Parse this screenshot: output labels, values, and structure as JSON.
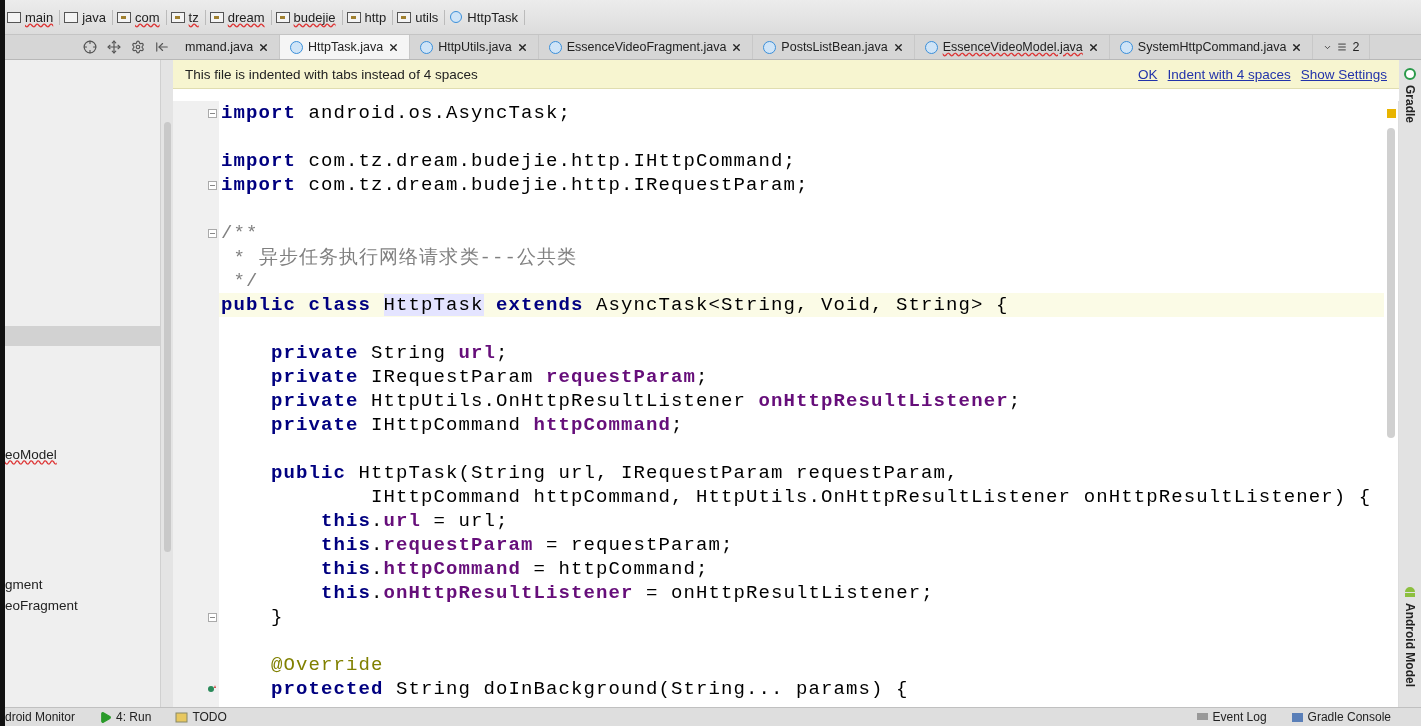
{
  "breadcrumbs": [
    {
      "label": "main",
      "kind": "folder",
      "misspelled": true
    },
    {
      "label": "java",
      "kind": "source",
      "misspelled": false
    },
    {
      "label": "com",
      "kind": "package",
      "misspelled": true
    },
    {
      "label": "tz",
      "kind": "package",
      "misspelled": true
    },
    {
      "label": "dream",
      "kind": "package",
      "misspelled": true
    },
    {
      "label": "budejie",
      "kind": "package",
      "misspelled": true
    },
    {
      "label": "http",
      "kind": "package",
      "misspelled": false
    },
    {
      "label": "utils",
      "kind": "package",
      "misspelled": false
    },
    {
      "label": "HttpTask",
      "kind": "class",
      "misspelled": false
    }
  ],
  "tabs": [
    {
      "label": "mmand.java",
      "selected": false,
      "misspelled": false,
      "icon": false
    },
    {
      "label": "HttpTask.java",
      "selected": true,
      "misspelled": false,
      "icon": true
    },
    {
      "label": "HttpUtils.java",
      "selected": false,
      "misspelled": false,
      "icon": true
    },
    {
      "label": "EssenceVideoFragment.java",
      "selected": false,
      "misspelled": false,
      "icon": true
    },
    {
      "label": "PostsListBean.java",
      "selected": false,
      "misspelled": false,
      "icon": true
    },
    {
      "label": "EssenceVideoModel.java",
      "selected": false,
      "misspelled": true,
      "icon": true
    },
    {
      "label": "SystemHttpCommand.java",
      "selected": false,
      "misspelled": false,
      "icon": true
    }
  ],
  "tab_overflow": "2",
  "project_tree": [
    {
      "selected": true
    },
    {
      "label": "eoModel",
      "selected": false,
      "misspelled": true
    },
    {
      "label": "gment",
      "selected": false,
      "misspelled": false
    },
    {
      "label": "eoFragment",
      "selected": false,
      "misspelled": false
    }
  ],
  "notification": {
    "message": "This file is indented with tabs instead of 4 spaces",
    "actions": [
      "OK",
      "Indent with 4 spaces",
      "Show Settings"
    ]
  },
  "code": [
    {
      "kind": "code",
      "fold": true,
      "tokens": [
        {
          "kind": "keyword",
          "text": "import"
        },
        {
          "kind": "plain",
          "text": " android.os.AsyncTask;"
        }
      ]
    },
    {
      "kind": "blank"
    },
    {
      "kind": "code",
      "tokens": [
        {
          "kind": "keyword",
          "text": "import"
        },
        {
          "kind": "plain",
          "text": " com.tz.dream.budejie.http.IHttpCommand;"
        }
      ]
    },
    {
      "kind": "code",
      "fold": true,
      "tokens": [
        {
          "kind": "keyword",
          "text": "import"
        },
        {
          "kind": "plain",
          "text": " com.tz.dream.budejie.http.IRequestParam;"
        }
      ]
    },
    {
      "kind": "blank"
    },
    {
      "kind": "code",
      "fold": true,
      "tokens": [
        {
          "kind": "comment",
          "text": "/**"
        }
      ]
    },
    {
      "kind": "code",
      "tokens": [
        {
          "kind": "comment",
          "text": " * 异步任务执行网络请求类---公共类"
        }
      ]
    },
    {
      "kind": "code",
      "tokens": [
        {
          "kind": "comment",
          "text": " */"
        }
      ]
    },
    {
      "kind": "code",
      "current": true,
      "tokens": [
        {
          "kind": "keyword",
          "text": "public class "
        },
        {
          "kind": "usage",
          "text": "HttpTask"
        },
        {
          "kind": "keyword",
          "text": " extends"
        },
        {
          "kind": "plain",
          "text": " AsyncTask<String, Void, String> {"
        }
      ]
    },
    {
      "kind": "blank"
    },
    {
      "kind": "code",
      "tokens": [
        {
          "kind": "keyword",
          "text": "    private"
        },
        {
          "kind": "plain",
          "text": " String "
        },
        {
          "kind": "field",
          "text": "url"
        },
        {
          "kind": "plain",
          "text": ";"
        }
      ]
    },
    {
      "kind": "code",
      "tokens": [
        {
          "kind": "keyword",
          "text": "    private"
        },
        {
          "kind": "plain",
          "text": " IRequestParam "
        },
        {
          "kind": "field",
          "text": "requestParam"
        },
        {
          "kind": "plain",
          "text": ";"
        }
      ]
    },
    {
      "kind": "code",
      "tokens": [
        {
          "kind": "keyword",
          "text": "    private"
        },
        {
          "kind": "plain",
          "text": " HttpUtils.OnHttpResultListener "
        },
        {
          "kind": "field",
          "text": "onHttpResultListener"
        },
        {
          "kind": "plain",
          "text": ";"
        }
      ]
    },
    {
      "kind": "code",
      "tokens": [
        {
          "kind": "keyword",
          "text": "    private"
        },
        {
          "kind": "plain",
          "text": " IHttpCommand "
        },
        {
          "kind": "field",
          "text": "httpCommand"
        },
        {
          "kind": "plain",
          "text": ";"
        }
      ]
    },
    {
      "kind": "blank"
    },
    {
      "kind": "code",
      "tokens": [
        {
          "kind": "keyword",
          "text": "    public"
        },
        {
          "kind": "plain",
          "text": " HttpTask(String url, IRequestParam requestParam,"
        }
      ]
    },
    {
      "kind": "code",
      "tokens": [
        {
          "kind": "plain",
          "text": "            IHttpCommand httpCommand, HttpUtils.OnHttpResultListener onHttpResultListener) {"
        }
      ]
    },
    {
      "kind": "code",
      "tokens": [
        {
          "kind": "keyword",
          "text": "        this"
        },
        {
          "kind": "plain",
          "text": "."
        },
        {
          "kind": "field",
          "text": "url"
        },
        {
          "kind": "plain",
          "text": " = url;"
        }
      ]
    },
    {
      "kind": "code",
      "tokens": [
        {
          "kind": "keyword",
          "text": "        this"
        },
        {
          "kind": "plain",
          "text": "."
        },
        {
          "kind": "field",
          "text": "requestParam"
        },
        {
          "kind": "plain",
          "text": " = requestParam;"
        }
      ]
    },
    {
      "kind": "code",
      "tokens": [
        {
          "kind": "keyword",
          "text": "        this"
        },
        {
          "kind": "plain",
          "text": "."
        },
        {
          "kind": "field",
          "text": "httpCommand"
        },
        {
          "kind": "plain",
          "text": " = httpCommand;"
        }
      ]
    },
    {
      "kind": "code",
      "tokens": [
        {
          "kind": "keyword",
          "text": "        this"
        },
        {
          "kind": "plain",
          "text": "."
        },
        {
          "kind": "field",
          "text": "onHttpResultListener"
        },
        {
          "kind": "plain",
          "text": " = onHttpResultListener;"
        }
      ]
    },
    {
      "kind": "code",
      "fold": true,
      "tokens": [
        {
          "kind": "plain",
          "text": "    }"
        }
      ]
    },
    {
      "kind": "blank"
    },
    {
      "kind": "code",
      "tokens": [
        {
          "kind": "annotation",
          "text": "    @Override"
        }
      ]
    },
    {
      "kind": "code",
      "override": true,
      "tokens": [
        {
          "kind": "keyword",
          "text": "    protected"
        },
        {
          "kind": "plain",
          "text": " String doInBackground(String... params) {"
        }
      ]
    }
  ],
  "bottom_bar": {
    "left": [
      {
        "label": "droid Monitor",
        "kind": "plain"
      },
      {
        "label": "4: Run",
        "kind": "run"
      },
      {
        "label": "TODO",
        "kind": "todo"
      }
    ],
    "right": [
      {
        "label": "Event Log",
        "kind": "log"
      },
      {
        "label": "Gradle Console",
        "kind": "console"
      }
    ]
  },
  "side_tools": [
    {
      "label": "Gradle",
      "kind": "gradle"
    },
    {
      "label": "Android Model",
      "kind": "android"
    }
  ]
}
